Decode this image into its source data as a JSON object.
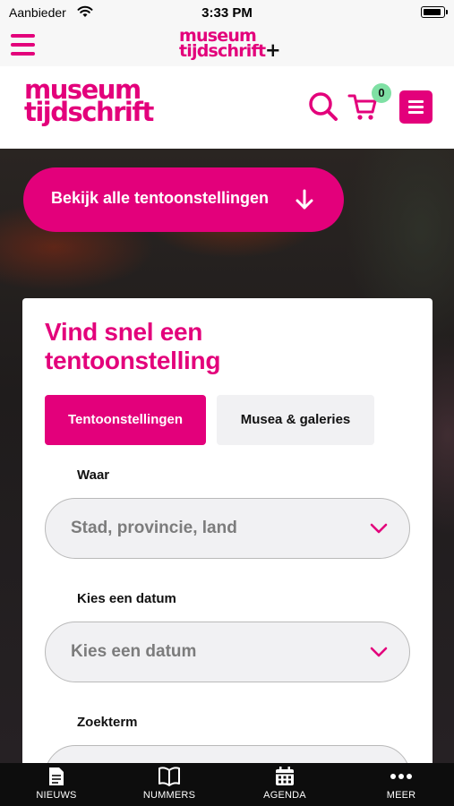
{
  "status_bar": {
    "carrier": "Aanbieder",
    "time": "3:33 PM",
    "battery_level": 0.95
  },
  "app_bar": {
    "logo_line1": "museum",
    "logo_line2": "tijdschrift",
    "logo_plus": "+"
  },
  "header": {
    "logo_line1": "museum",
    "logo_line2": "tijdschrift",
    "cart_count": "0"
  },
  "hero": {
    "button_label": "Bekijk alle tentoonstellingen"
  },
  "finder": {
    "title": "Vind snel een tentoonstelling",
    "tabs": [
      {
        "label": "Tentoonstellingen",
        "active": true
      },
      {
        "label": "Musea & galeries",
        "active": false
      }
    ],
    "fields": [
      {
        "label": "Waar",
        "value": "Stad, provincie, land"
      },
      {
        "label": "Kies een datum",
        "value": "Kies een datum"
      },
      {
        "label": "Zoekterm",
        "value": ""
      }
    ]
  },
  "tab_bar": {
    "items": [
      {
        "label": "NIEUWS",
        "icon": "document-icon"
      },
      {
        "label": "NUMMERS",
        "icon": "book-icon"
      },
      {
        "label": "AGENDA",
        "icon": "calendar-icon"
      },
      {
        "label": "MEER",
        "icon": "more-icon"
      }
    ]
  },
  "colors": {
    "accent": "#e3007b",
    "badge": "#7fe0a4",
    "tab_bar": "#0d0d0d"
  }
}
